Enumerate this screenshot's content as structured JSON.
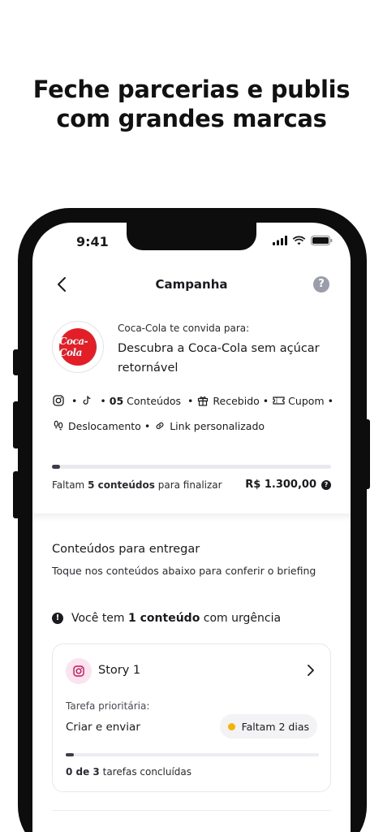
{
  "headline": {
    "line1": "Feche parcerias e publis",
    "line2": "com grandes marcas"
  },
  "status_bar": {
    "time": "9:41"
  },
  "nav": {
    "title": "Campanha",
    "help": "?"
  },
  "brand": {
    "logo_text": "Coca-Cola"
  },
  "campaign": {
    "invite": "Coca-Cola te convida para:",
    "name": "Descubra a Coca-Cola sem açúcar retornável"
  },
  "deliverables": {
    "count": "05",
    "count_label": "Conteúdos",
    "received": "Recebido",
    "coupon": "Cupom",
    "travel": "Deslocamento",
    "link": "Link personalizado"
  },
  "progress": {
    "fraction": 0.03,
    "remaining_prefix": "Faltam",
    "remaining_count": "5 conteúdos",
    "remaining_suffix": "para finalizar",
    "price": "R$ 1.300,00"
  },
  "contents_section": {
    "title": "Conteúdos para entregar",
    "subtitle": "Toque nos conteúdos abaixo para conferir o briefing"
  },
  "urgency": {
    "prefix": "Você tem",
    "count": "1 conteúdo",
    "suffix": "com urgência"
  },
  "card": {
    "title": "Story 1",
    "task_label": "Tarefa prioritária:",
    "task_value": "Criar e enviar",
    "deadline": "Faltam 2 dias",
    "progress_fraction": 0.03,
    "footer_count": "0 de 3",
    "footer_suffix": "tarefas concluídas"
  },
  "colors": {
    "brand_red": "#e41e26",
    "deadline_dot": "#f2b400",
    "progress": "#3b3d4a",
    "instagram_bg": "#fbe3f0",
    "instagram_icon": "#c2185b"
  }
}
